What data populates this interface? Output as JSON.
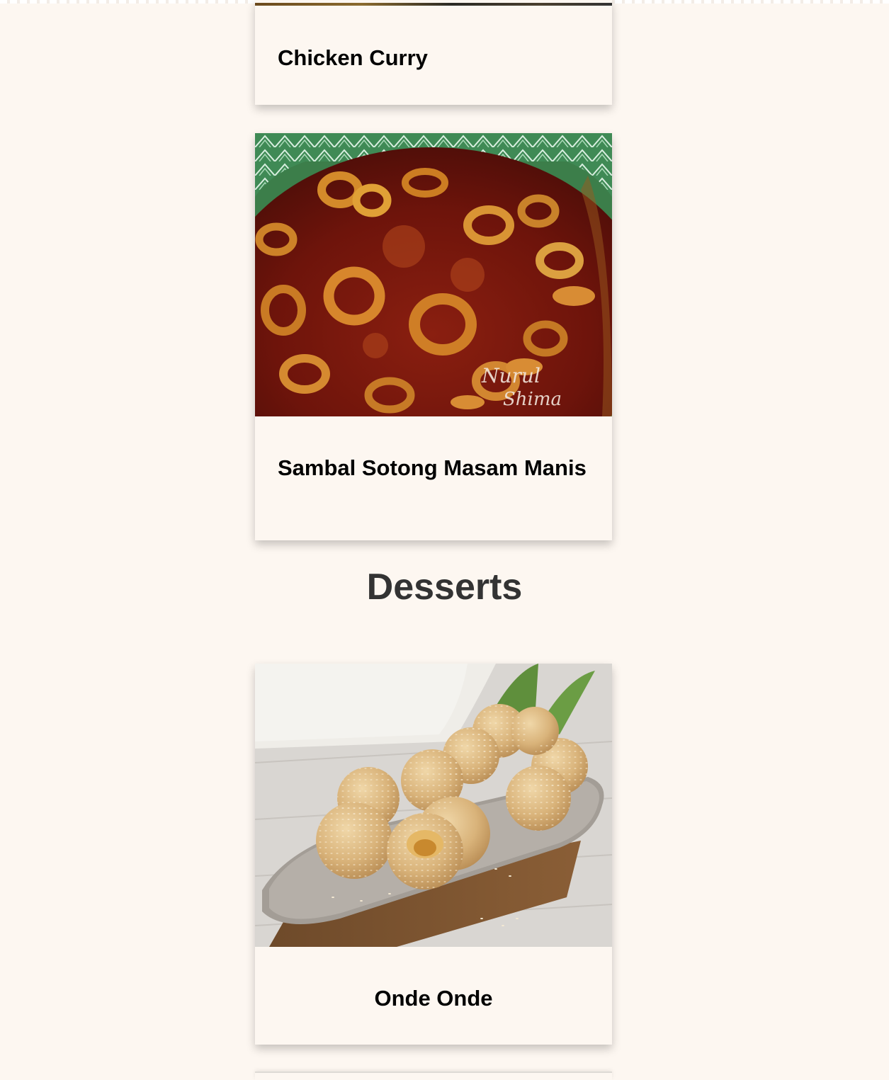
{
  "recipes": [
    {
      "title": "Chicken Curry"
    },
    {
      "title": "Sambal Sotong Masam Manis",
      "watermark": "Nurul Shima"
    },
    {
      "title": "Onde Onde"
    }
  ],
  "sections": {
    "desserts": "Desserts"
  },
  "colors": {
    "background": "#fdf7f1",
    "heading": "#333333",
    "card_title": "#000000"
  }
}
